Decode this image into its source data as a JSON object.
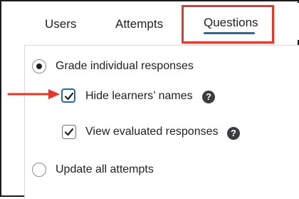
{
  "tabs": {
    "users": "Users",
    "attempts": "Attempts",
    "questions": "Questions"
  },
  "options": {
    "grade_individual": "Grade individual responses",
    "hide_names": "Hide learners’ names",
    "view_evaluated": "View evaluated responses",
    "update_all": "Update all attempts",
    "help_glyph": "?"
  },
  "state": {
    "grade_individual_selected": true,
    "hide_names_checked": true,
    "view_evaluated_checked": true,
    "update_all_selected": false,
    "active_tab": "Questions"
  },
  "colors": {
    "highlight_box": "#e8362b",
    "annotation_arrow": "#e8362b",
    "tab_underline": "#1e6fa8",
    "focus_ring": "#1e6fa8"
  },
  "icons": {
    "checkmark": "checkmark-icon",
    "help": "help-icon",
    "arrow": "arrow-right-icon"
  }
}
